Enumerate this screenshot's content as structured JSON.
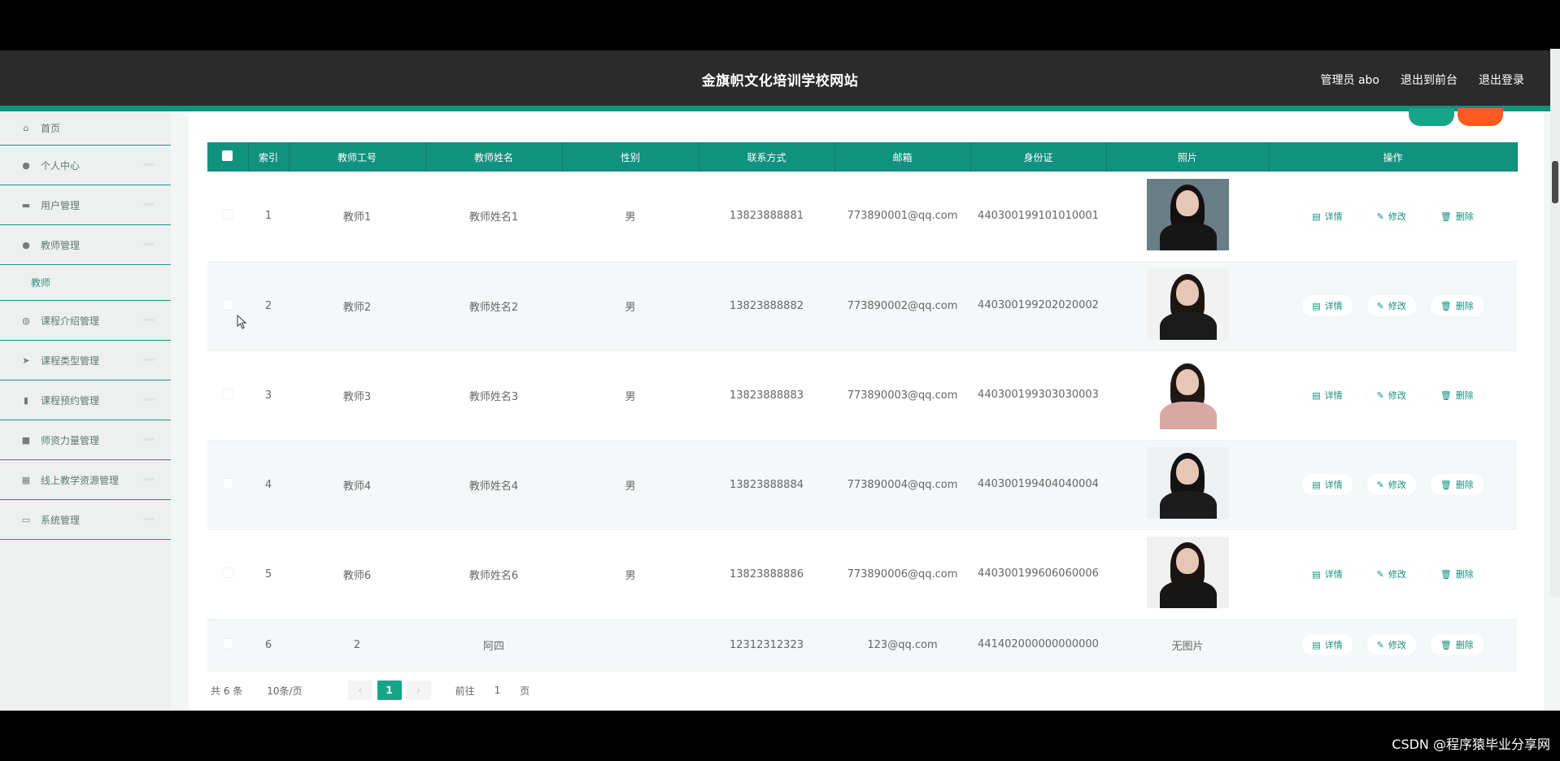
{
  "header": {
    "title": "金旗帜文化培训学校网站",
    "admin": "管理员 abo",
    "to_front": "退出到前台",
    "logout": "退出登录"
  },
  "sidebar": {
    "items": [
      {
        "label": "首页",
        "icon": "home-icon"
      },
      {
        "label": "个人中心",
        "icon": "user-icon"
      },
      {
        "label": "用户管理",
        "icon": "monitor-icon"
      },
      {
        "label": "教师管理",
        "icon": "user-icon"
      },
      {
        "label": "课程介绍管理",
        "icon": "globe-icon"
      },
      {
        "label": "课程类型管理",
        "icon": "send-icon"
      },
      {
        "label": "课程预约管理",
        "icon": "bar-chart-icon"
      },
      {
        "label": "师资力量管理",
        "icon": "briefcase-icon"
      },
      {
        "label": "线上教学资源管理",
        "icon": "grid-icon"
      },
      {
        "label": "系统管理",
        "icon": "window-icon"
      }
    ],
    "sub_item": "教师"
  },
  "table": {
    "headers": [
      "索引",
      "教师工号",
      "教师姓名",
      "性别",
      "联系方式",
      "邮箱",
      "身份证",
      "照片",
      "操作"
    ],
    "rows": [
      {
        "index": "1",
        "id": "教师1",
        "name": "教师姓名1",
        "gender": "男",
        "phone": "13823888881",
        "email": "773890001@qq.com",
        "idcard": "440300199101010001",
        "photo": "photo"
      },
      {
        "index": "2",
        "id": "教师2",
        "name": "教师姓名2",
        "gender": "男",
        "phone": "13823888882",
        "email": "773890002@qq.com",
        "idcard": "440300199202020002",
        "photo": "photo"
      },
      {
        "index": "3",
        "id": "教师3",
        "name": "教师姓名3",
        "gender": "男",
        "phone": "13823888883",
        "email": "773890003@qq.com",
        "idcard": "440300199303030003",
        "photo": "photo"
      },
      {
        "index": "4",
        "id": "教师4",
        "name": "教师姓名4",
        "gender": "男",
        "phone": "13823888884",
        "email": "773890004@qq.com",
        "idcard": "440300199404040004",
        "photo": "photo"
      },
      {
        "index": "5",
        "id": "教师6",
        "name": "教师姓名6",
        "gender": "男",
        "phone": "13823888886",
        "email": "773890006@qq.com",
        "idcard": "440300199606060006",
        "photo": "photo"
      },
      {
        "index": "6",
        "id": "2",
        "name": "阿四",
        "gender": "",
        "phone": "12312312323",
        "email": "123@qq.com",
        "idcard": "441402000000000000",
        "photo": "无图片"
      }
    ],
    "actions": {
      "detail": "详情",
      "edit": "修改",
      "delete": "删除"
    }
  },
  "pagination": {
    "total": "共 6 条",
    "page_size": "10条/页",
    "current_page": "1",
    "goto_label": "前往",
    "goto_value": "1",
    "page_unit": "页"
  },
  "watermark": "CSDN @程序猿毕业分享网",
  "colors": {
    "accent": "#11927e",
    "navbar": "#2b2b2b",
    "danger": "#ff5a1f"
  }
}
